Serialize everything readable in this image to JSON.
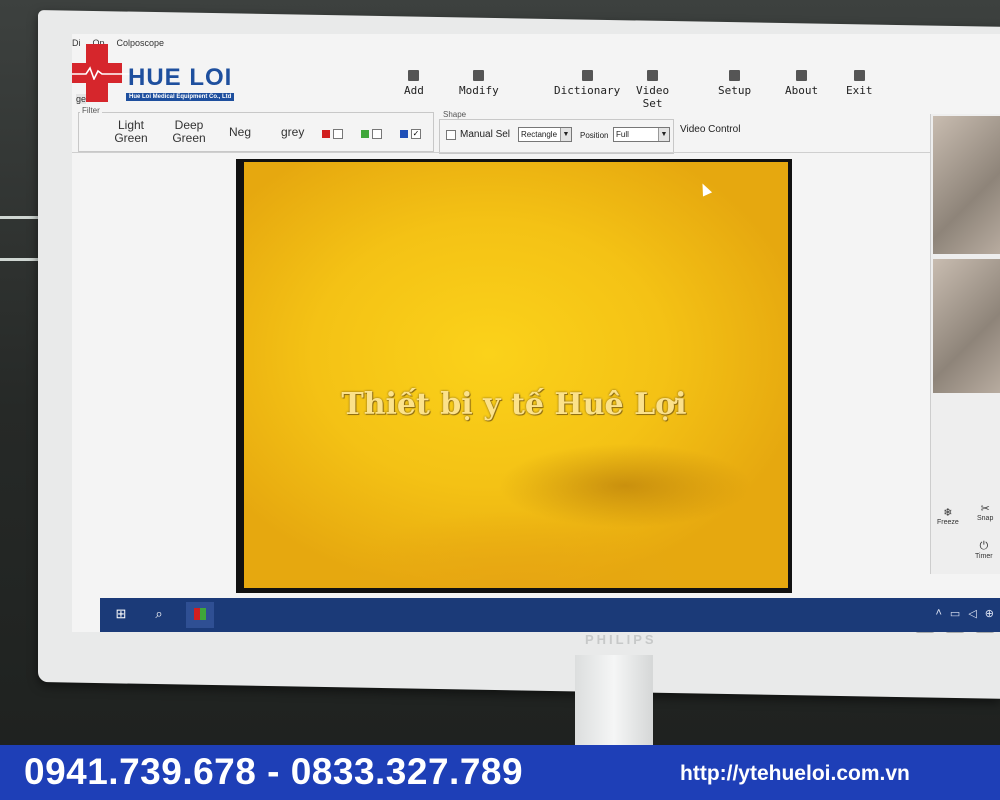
{
  "app": {
    "menus": [
      "Di",
      "Op",
      "Colposcope"
    ],
    "logo_text": "HUE LOI",
    "logo_subtitle": "Hue Loi Medical Equipment Co., Ltd",
    "logo_side_text": "ge",
    "toolbar": [
      {
        "label": "Add",
        "icon": "add-icon"
      },
      {
        "label": "Modify",
        "icon": "modify-icon"
      },
      {
        "label": "Dictionary",
        "icon": "dictionary-icon"
      },
      {
        "label": "Video Set",
        "icon": "video-set-icon"
      },
      {
        "label": "Setup",
        "icon": "gear-icon"
      },
      {
        "label": "About",
        "icon": "about-icon"
      },
      {
        "label": "Exit",
        "icon": "power-icon"
      }
    ],
    "filter": {
      "title": "Filter",
      "buttons": [
        "Light Green",
        "Deep Green",
        "Neg",
        "grey"
      ],
      "colors": [
        {
          "color": "#d11f1f",
          "checked": false
        },
        {
          "color": "#3fa63a",
          "checked": false
        },
        {
          "color": "#1f4fb7",
          "checked": true
        }
      ]
    },
    "shape": {
      "title": "Shape",
      "manual_sel_label": "Manual Sel",
      "manual_sel_checked": false,
      "shape_value": "Rectangle",
      "position_label": "Position",
      "position_value": "Full"
    },
    "video_control_label": "Video Control",
    "watermark": "Thiết bị y tế Huê Lợi",
    "right_panel": {
      "freeze_label": "Freeze",
      "snap_label": "Snap",
      "timer_label": "Timer"
    }
  },
  "monitor": {
    "brand": "PHILIPS"
  },
  "banner": {
    "phones": "0941.739.678 - 0833.327.789",
    "website": "http://ytehueloi.com.vn"
  }
}
